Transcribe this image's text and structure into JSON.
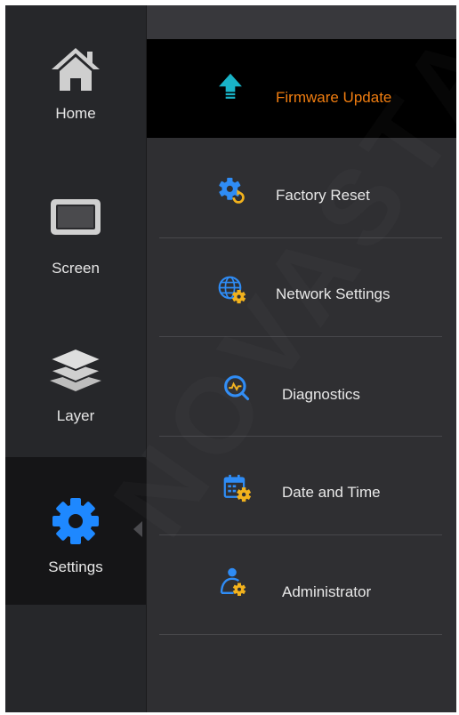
{
  "nav": {
    "items": [
      {
        "label": "Home",
        "icon": "home-icon"
      },
      {
        "label": "Screen",
        "icon": "screen-icon"
      },
      {
        "label": "Layer",
        "icon": "layers-icon"
      },
      {
        "label": "Settings",
        "icon": "gear-icon",
        "active": true
      }
    ]
  },
  "submenu": {
    "items": [
      {
        "label": "Firmware Update",
        "icon": "upload-arrow-icon",
        "selected": true
      },
      {
        "label": "Factory Reset",
        "icon": "gear-reset-icon"
      },
      {
        "label": "Network Settings",
        "icon": "globe-gear-icon"
      },
      {
        "label": "Diagnostics",
        "icon": "diagnostics-icon"
      },
      {
        "label": "Date and Time",
        "icon": "calendar-gear-icon"
      },
      {
        "label": "Administrator",
        "icon": "user-gear-icon"
      }
    ]
  },
  "watermark": "NOVASTAR",
  "colors": {
    "accent_orange": "#f07d10",
    "settings_blue": "#1e88ff",
    "arrow_teal": "#19b3c7",
    "icon_gold": "#f2b21d",
    "icon_blue": "#2f8cf5"
  }
}
